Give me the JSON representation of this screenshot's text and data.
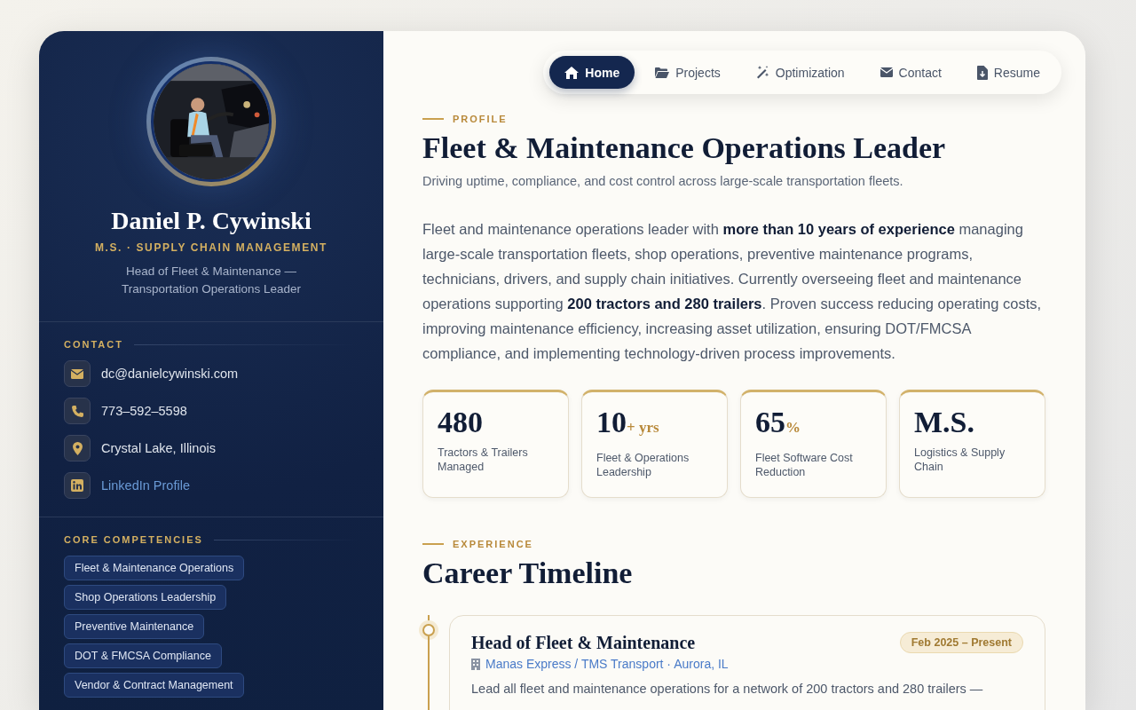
{
  "profile": {
    "name": "Daniel P. Cywinski",
    "degree": "M.S. · SUPPLY CHAIN MANAGEMENT",
    "tagline": "Head of Fleet & Maintenance — Transportation Operations Leader"
  },
  "contact": {
    "heading": "CONTACT",
    "items": [
      {
        "kind": "email",
        "text": "dc@danielcywinski.com"
      },
      {
        "kind": "phone",
        "text": "773–592–5598"
      },
      {
        "kind": "location",
        "text": "Crystal Lake, Illinois"
      },
      {
        "kind": "linkedin",
        "text": "LinkedIn Profile"
      }
    ]
  },
  "competencies": {
    "heading": "CORE COMPETENCIES",
    "items": [
      "Fleet & Maintenance Operations",
      "Shop Operations Leadership",
      "Preventive Maintenance",
      "DOT & FMCSA Compliance",
      "Vendor & Contract Management"
    ]
  },
  "nav": [
    {
      "kind": "home",
      "label": "Home",
      "selected": true
    },
    {
      "kind": "folder",
      "label": "Projects",
      "selected": false
    },
    {
      "kind": "wand",
      "label": "Optimization",
      "selected": false
    },
    {
      "kind": "envelope",
      "label": "Contact",
      "selected": false
    },
    {
      "kind": "file",
      "label": "Resume",
      "selected": false
    }
  ],
  "intro": {
    "eyebrow": "PROFILE",
    "title": "Fleet & Maintenance Operations Leader",
    "subtitle": "Driving uptime, compliance, and cost control across large-scale transportation fleets.",
    "body": "Fleet and maintenance operations leader with **more than 10 years of experience** managing large-scale transportation fleets, shop operations, preventive maintenance programs, technicians, drivers, and supply chain initiatives. Currently overseeing fleet and maintenance operations supporting **200 tractors and 280 trailers**. Proven success reducing operating costs, improving maintenance efficiency, increasing asset utilization, ensuring DOT/FMCSA compliance, and implementing technology-driven process improvements."
  },
  "stats": [
    {
      "value": "480",
      "label": "Tractors & Trailers Managed"
    },
    {
      "value": "10",
      "suffix": "+ yrs",
      "label": "Fleet & Operations Leadership"
    },
    {
      "value": "65",
      "suffix": "%",
      "label": "Fleet Software Cost Reduction"
    },
    {
      "value": "M.S.",
      "label": "Logistics & Supply Chain"
    }
  ],
  "experience": {
    "eyebrow": "EXPERIENCE",
    "title": "Career Timeline",
    "jobs": [
      {
        "title": "Head of Fleet & Maintenance",
        "dates": "Feb 2025 – Present",
        "company": "Manas Express / TMS Transport · Aurora, IL",
        "summary": "Lead all fleet and maintenance operations for a network of 200 tractors and 280 trailers —"
      }
    ]
  }
}
